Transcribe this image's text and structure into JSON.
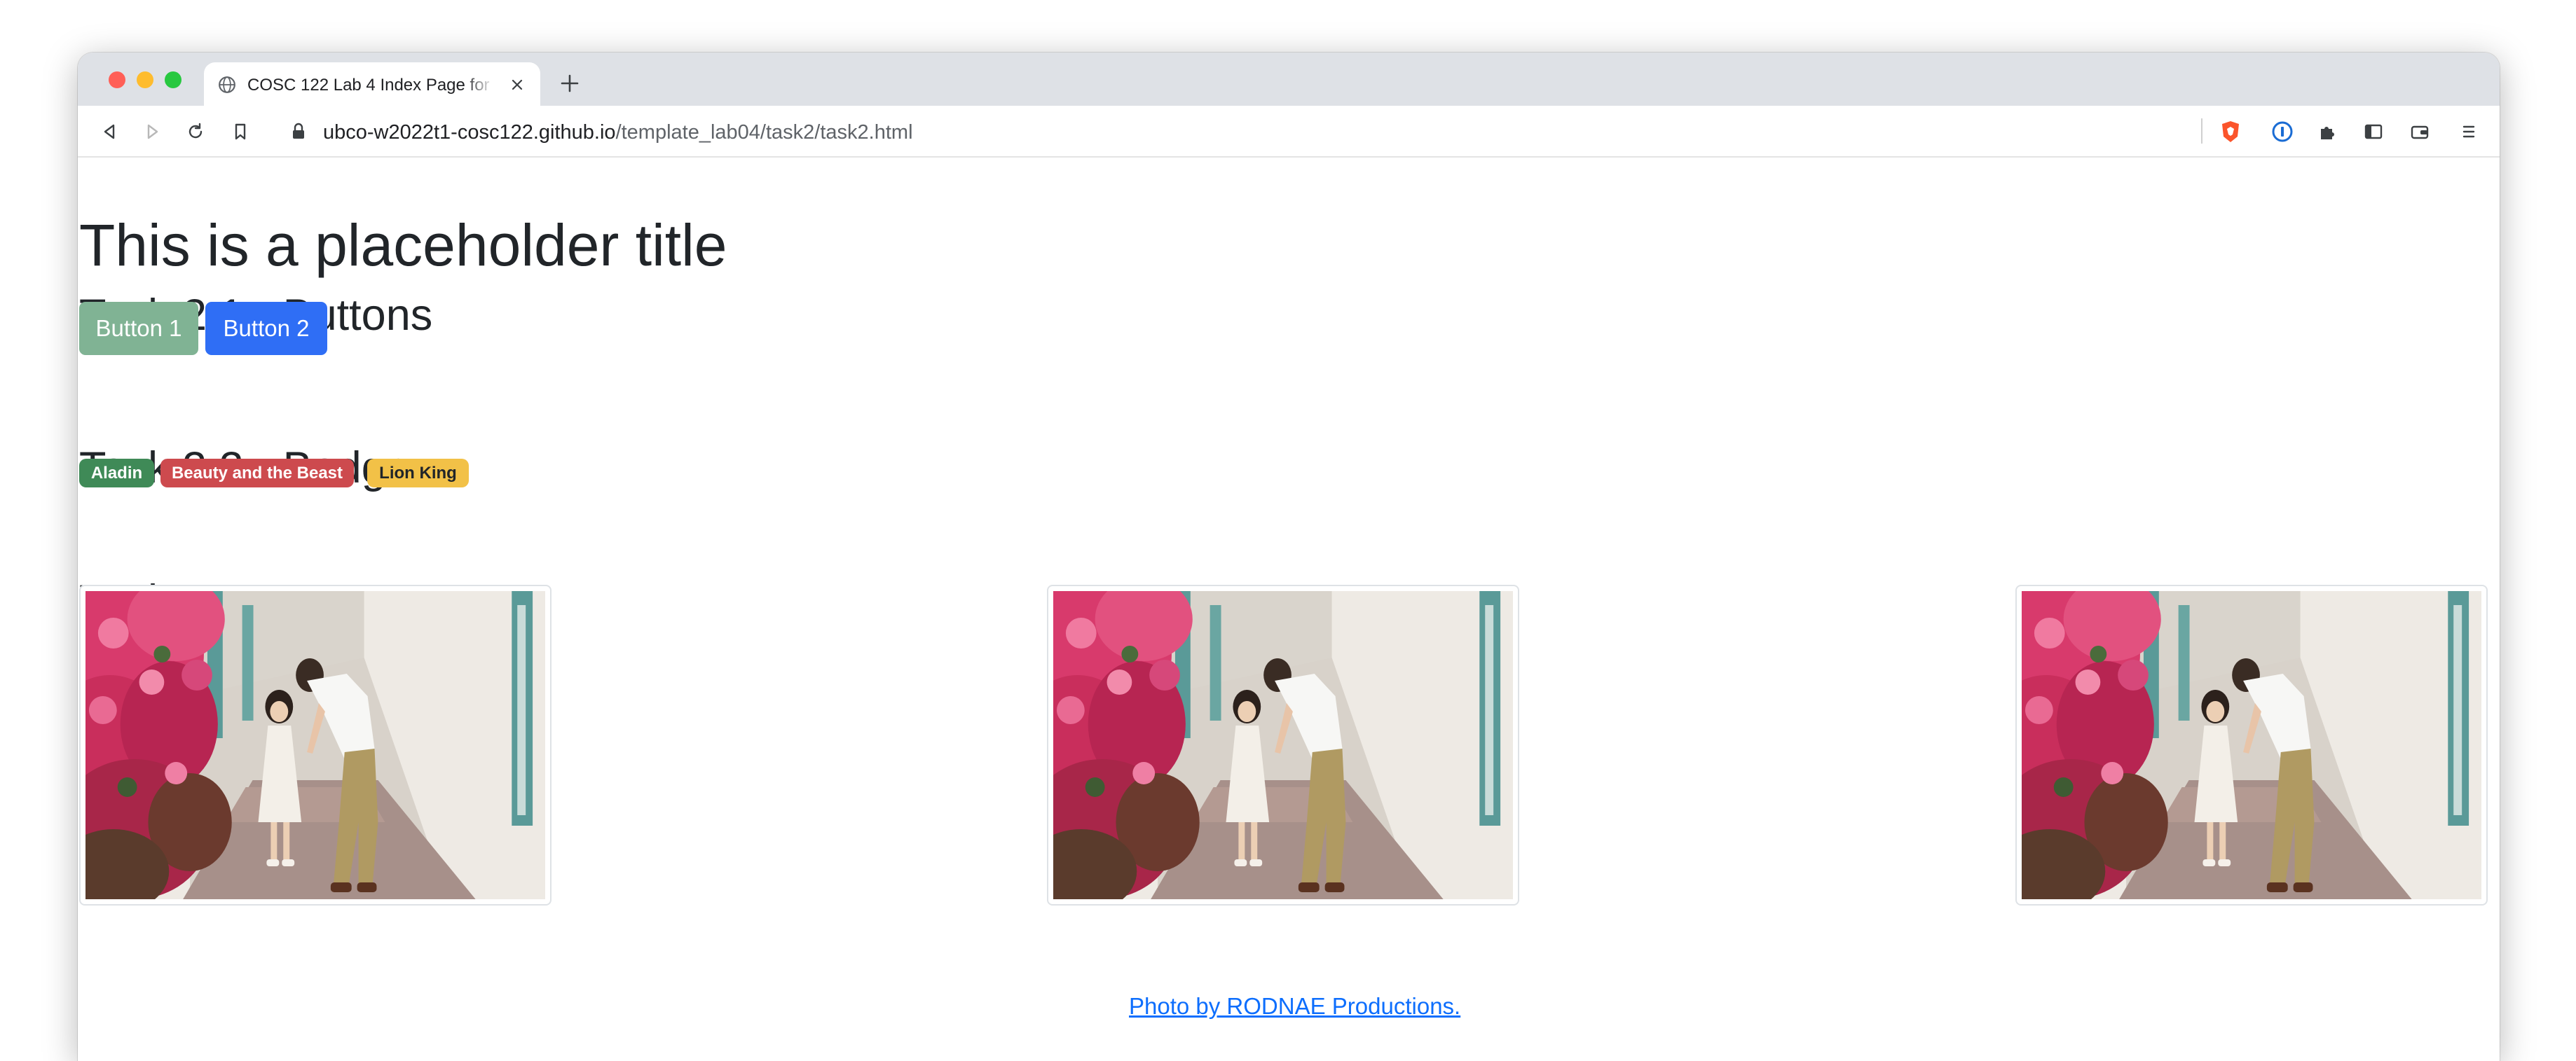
{
  "browser": {
    "tab_title": "COSC 122 Lab 4 Index Page for",
    "url": {
      "host": "ubco-w2022t1-cosc122.github.io",
      "path": "/template_lab04/task2/task2.html"
    },
    "icons": [
      "globe-icon",
      "close-icon",
      "plus-icon",
      "back-icon",
      "forward-icon",
      "reload-icon",
      "bookmark-icon",
      "lock-icon",
      "brave-shield-icon",
      "password-manager-icon",
      "extensions-icon",
      "sidebar-icon",
      "wallet-icon",
      "menu-icon"
    ]
  },
  "page": {
    "title": "This is a placeholder title",
    "task21": {
      "heading": "Task 2.1 - Buttons",
      "buttons": [
        "Button 1",
        "Button 2"
      ]
    },
    "task22": {
      "heading": "Task 2.2 - Badges",
      "badges": [
        "Aladin",
        "Beauty and the Beast",
        "Lion King"
      ]
    },
    "task23": {
      "heading": "Task 2.3 - Images",
      "credit": "Photo by RODNAE Productions."
    }
  },
  "colors": {
    "button1": "#80b394",
    "button2": "#2f6ef5",
    "badge_success": "#3f8a57",
    "badge_danger": "#cd4a4e",
    "badge_warning": "#f2c147",
    "link": "#0d6efd"
  }
}
